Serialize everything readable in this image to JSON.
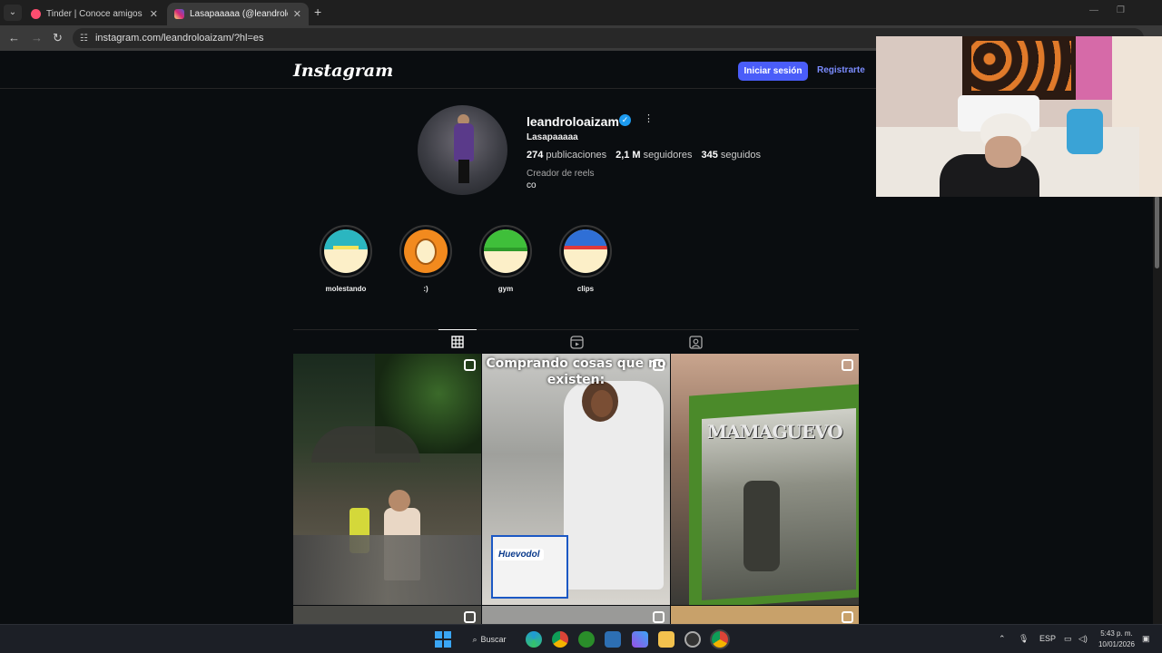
{
  "browser": {
    "tabs": [
      {
        "title": "Tinder | Conoce amigos y gente",
        "favicon_color": "#fd4d6f"
      },
      {
        "title": "Lasapaaaaa (@leandroloaizam)",
        "favicon_color": "#d62976"
      }
    ],
    "url": "instagram.com/leandroloaizam/?hl=es"
  },
  "instagram": {
    "logo": "Instagram",
    "login_label": "Iniciar sesión",
    "register_label": "Registrarte",
    "profile": {
      "username": "leandroloaizam",
      "verified": true,
      "full_name": "Lasapaaaaa",
      "posts_count": "274",
      "posts_label": "publicaciones",
      "followers_count": "2,1 M",
      "followers_label": "seguidores",
      "following_count": "345",
      "following_label": "seguidos",
      "category": "Creador de reels",
      "bio": "co"
    },
    "highlights": [
      {
        "label": "molestando"
      },
      {
        "label": ":)"
      },
      {
        "label": "gym"
      },
      {
        "label": "clips"
      }
    ],
    "tabs": [
      "posts-grid",
      "reels",
      "tagged"
    ],
    "posts": [
      {
        "caption": ""
      },
      {
        "caption": "Comprando cosas que no existen:",
        "product_label": "Huevodol"
      },
      {
        "caption": "",
        "game_title": "MAMAGUEVO"
      }
    ]
  },
  "taskbar": {
    "search_label": "Buscar",
    "language": "ESP",
    "time": "5:43 p. m.",
    "date": "10/01/2026"
  }
}
